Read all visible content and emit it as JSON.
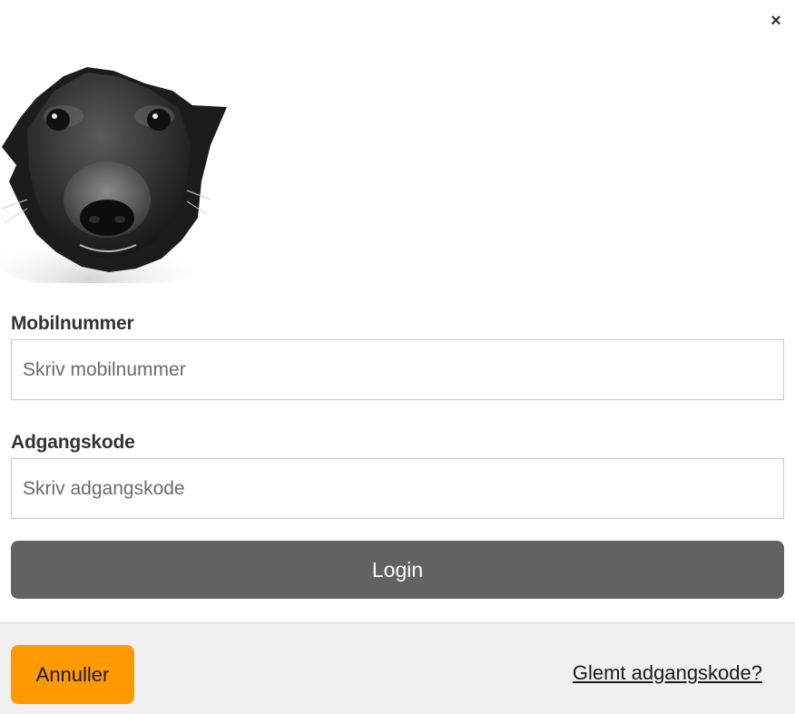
{
  "dialog": {
    "close_label": "×"
  },
  "hero": {
    "icon": "dog-photo"
  },
  "form": {
    "phone_label": "Mobilnummer",
    "phone_placeholder": "Skriv mobilnummer",
    "phone_value": "",
    "password_label": "Adgangskode",
    "password_placeholder": "Skriv adgangskode",
    "password_value": "",
    "login_label": "Login"
  },
  "footer": {
    "cancel_label": "Annuller",
    "forgot_label": "Glemt adgangskode?"
  },
  "colors": {
    "login_button": "#626262",
    "cancel_button": "#ff9a00",
    "footer_bg": "#f0f0f0"
  }
}
